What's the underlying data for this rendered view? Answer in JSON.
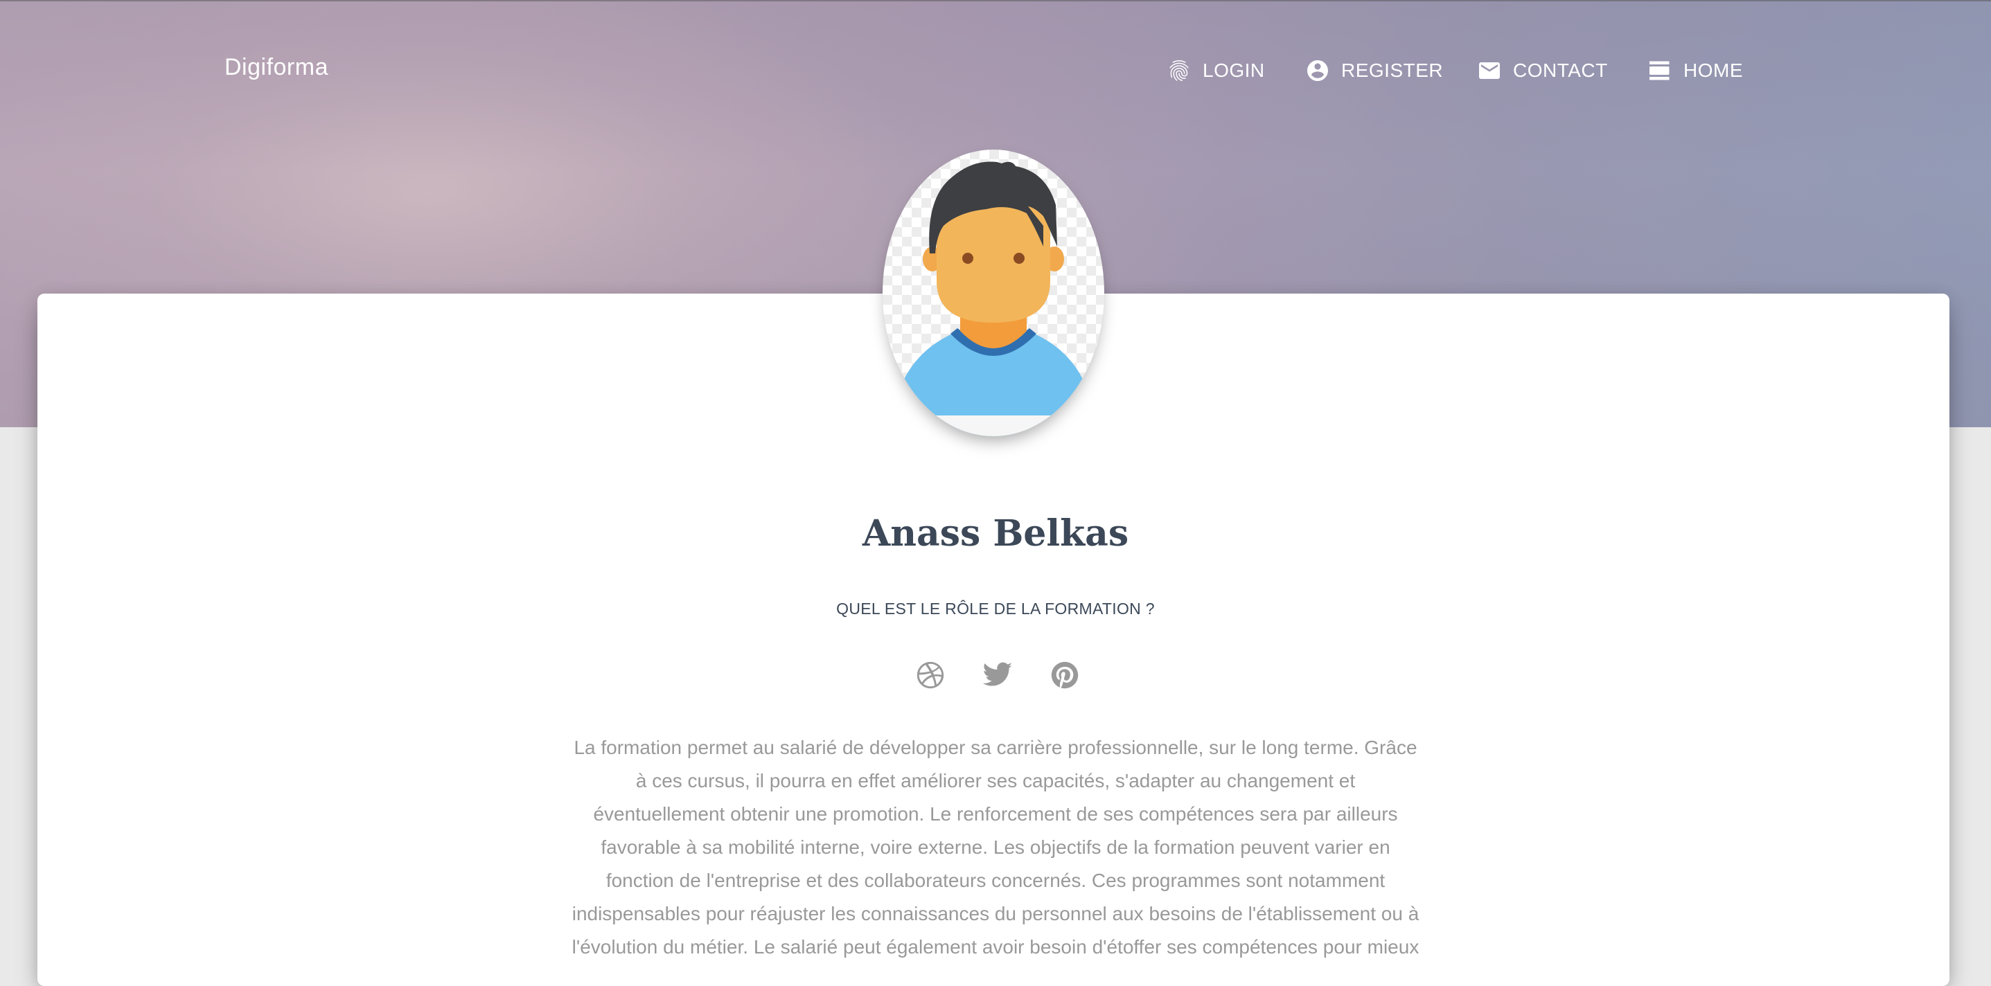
{
  "brand": "Digiforma",
  "nav": {
    "login": "LOGIN",
    "register": "REGISTER",
    "contact": "CONTACT",
    "home": "HOME"
  },
  "profile": {
    "name": "Anass Belkas",
    "subtitle": "QUEL EST LE RÔLE DE LA FORMATION ?",
    "socials": [
      "dribbble-icon",
      "twitter-icon",
      "pinterest-icon"
    ],
    "description": "La formation permet au salarié de développer sa carrière professionnelle, sur le long terme. Grâce à ces cursus, il pourra en effet améliorer ses capacités, s'adapter au changement et éventuellement obtenir une promotion. Le renforcement de ses compétences sera par ailleurs favorable à sa mobilité interne, voire externe. Les objectifs de la formation peuvent varier en fonction de l'entreprise et des collaborateurs concernés. Ces programmes sont notamment indispensables pour réajuster les connaissances du personnel aux besoins de l'établissement ou à l'évolution du métier. Le salarié peut également avoir besoin d'étoffer ses compétences pour mieux"
  },
  "colors": {
    "title": "#3c4858",
    "muted": "#999999",
    "nav_text": "#ffffff"
  }
}
